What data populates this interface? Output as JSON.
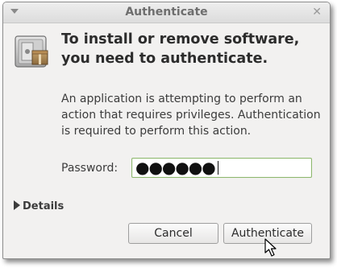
{
  "window": {
    "title": "Authenticate",
    "menu_icon": "chevron-down-icon",
    "close_glyph": "✕"
  },
  "header": {
    "icon": "package-lock-icon",
    "heading": "To install or remove software, you need to authenticate."
  },
  "message": "An application is attempting to perform an action that requires privileges. Authentication is required to perform this action.",
  "password": {
    "label": "Password:",
    "masked_value": "●●●●●●"
  },
  "details": {
    "label": "Details",
    "expanded": false
  },
  "buttons": {
    "cancel": "Cancel",
    "authenticate": "Authenticate"
  },
  "colors": {
    "window_bg": "#f2f1f0",
    "focus_border": "#8fb870",
    "text": "#3c3c3c"
  }
}
